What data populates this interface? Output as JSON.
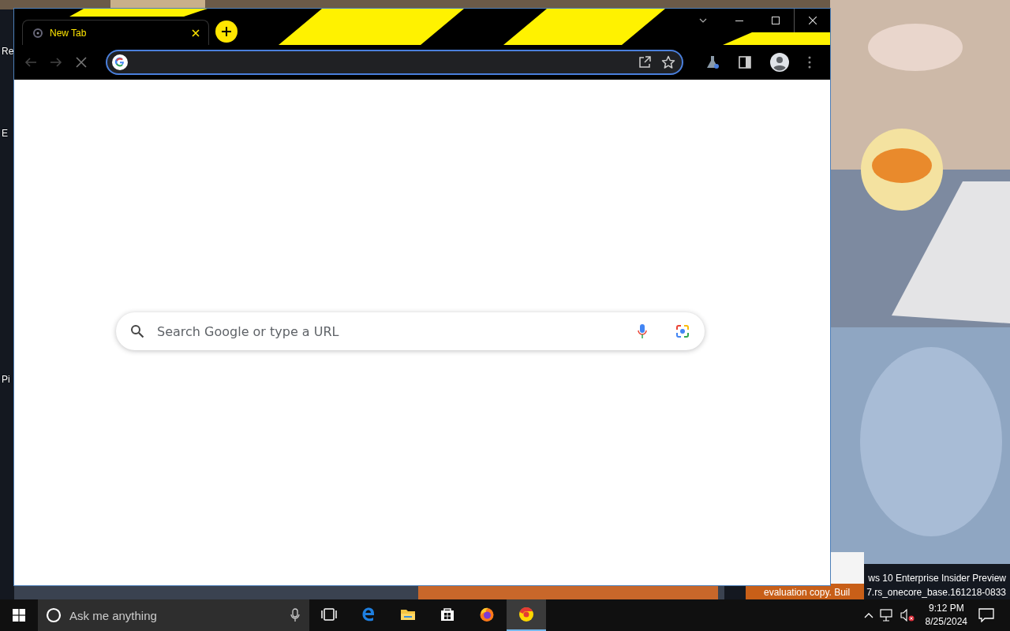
{
  "desktop": {
    "icons": [
      {
        "label": "Re"
      },
      {
        "label": "E"
      },
      {
        "label": "Pi"
      }
    ],
    "watermark": {
      "line_1": "ws 10 Enterprise Insider Preview",
      "line_2_start": "evaluation copy. Buil",
      "line_2_end": "7.rs_onecore_base.161218-0833"
    }
  },
  "browser": {
    "tabs": [
      {
        "label": "New Tab",
        "selected": true
      }
    ],
    "loading": true,
    "new_tab_page": {
      "search": {
        "placeholder": "Search Google or type a URL"
      }
    }
  },
  "taskbar": {
    "search": {
      "placeholder": "Ask me anything"
    },
    "apps": [
      {
        "kind": "task-view",
        "selected": false
      },
      {
        "kind": "edge",
        "selected": false
      },
      {
        "kind": "explorer",
        "selected": false
      },
      {
        "kind": "store",
        "selected": false
      },
      {
        "kind": "firefox",
        "selected": false
      },
      {
        "kind": "chrome",
        "selected": true
      }
    ],
    "tray": {
      "muted": true
    },
    "clock": {
      "time": "9:12 PM",
      "date": "8/25/2024"
    }
  }
}
